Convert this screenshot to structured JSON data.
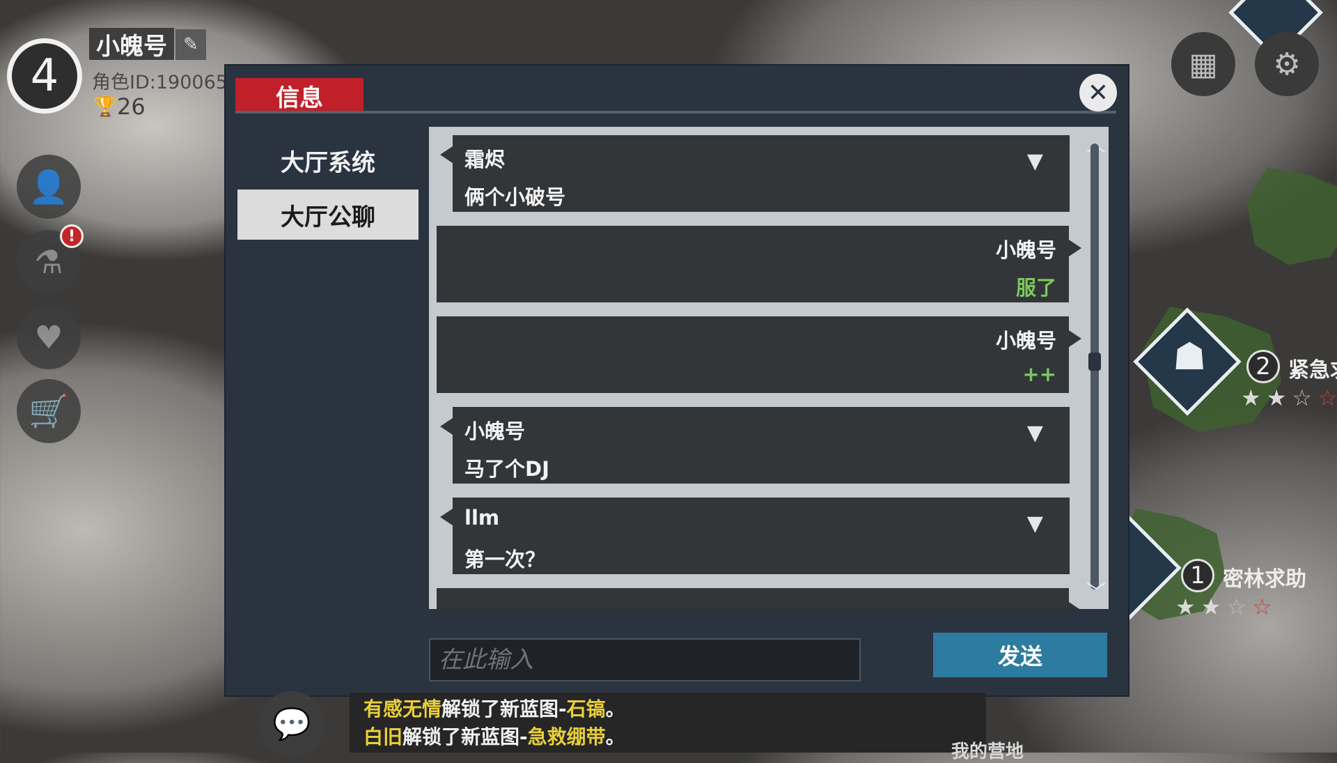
{
  "player": {
    "level": "4",
    "nickname": "小魄号",
    "role_id": "角色ID:190065",
    "trophies": "26"
  },
  "icons": {
    "edit": "pencil-icon",
    "profile": "person-icon",
    "lab": "flask-icon",
    "social": "handshake-heart-icon",
    "shop": "cart-icon",
    "calendar": "calendar-icon",
    "settings": "gear-icon",
    "chat": "speech-bubble-icon",
    "close": "close-icon"
  },
  "dialog": {
    "title": "信息",
    "tabs": [
      {
        "label": "大厅系统",
        "active": false
      },
      {
        "label": "大厅公聊",
        "active": true
      }
    ],
    "messages": [
      {
        "side": "left",
        "name": "霜烬",
        "text": "俩个小破号"
      },
      {
        "side": "right",
        "name": "小魄号",
        "text": "服了"
      },
      {
        "side": "right",
        "name": "小魄号",
        "text": "++"
      },
      {
        "side": "left",
        "name": "小魄号",
        "text": "马了个DJ"
      },
      {
        "side": "left",
        "name": "llm",
        "text": "第一次？"
      }
    ],
    "input_placeholder": "在此输入",
    "send_label": "发送"
  },
  "map": {
    "missions": [
      {
        "number": "2",
        "name": "紧急求",
        "stars_earned": 2,
        "stars_total": 4
      },
      {
        "number": "1",
        "name": "密林求助",
        "stars_earned": 2,
        "stars_total": 4
      }
    ],
    "base_label": "我的营地"
  },
  "feed": {
    "line1": {
      "player": "有感无情",
      "action": "解锁了新蓝图-",
      "item": "石镐",
      "end": "。"
    },
    "line2": {
      "player": "白旧",
      "action": "解锁了新蓝图-",
      "item": "急救绷带",
      "end": "。"
    }
  },
  "colors": {
    "accent_red": "#c0202a",
    "send_blue": "#2d7b9e",
    "highlight_yellow": "#e8cf3a",
    "reply_green": "#7cc75c"
  }
}
